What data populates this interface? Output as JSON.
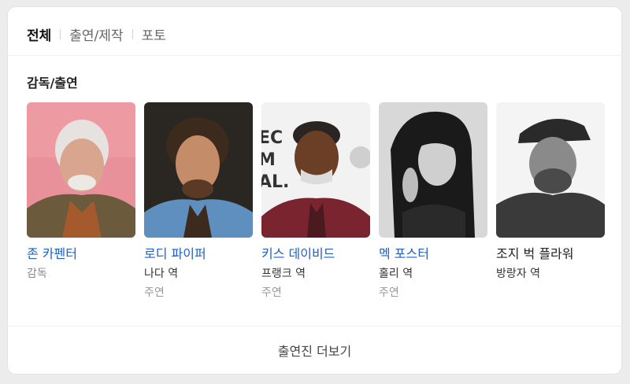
{
  "tabs": [
    {
      "label": "전체"
    },
    {
      "label": "출연/제작"
    },
    {
      "label": "포토"
    }
  ],
  "section_title": "감독/출연",
  "people": [
    {
      "name": "존 카펜터",
      "role": "감독",
      "sub": ""
    },
    {
      "name": "로디 파이퍼",
      "role": "나다 역",
      "sub": "주연"
    },
    {
      "name": "키스 데이비드",
      "role": "프랭크 역",
      "sub": "주연"
    },
    {
      "name": "멕 포스터",
      "role": "홀리 역",
      "sub": "주연"
    },
    {
      "name": "조지 벅 플라워",
      "role": "방랑자 역",
      "sub": ""
    }
  ],
  "photo_backdrop_text": [
    "EC",
    "M",
    "AL."
  ],
  "more_label": "출연진 더보기",
  "colors": {
    "link": "#2160c4",
    "active_tab": "#111111",
    "muted": "#999999"
  }
}
